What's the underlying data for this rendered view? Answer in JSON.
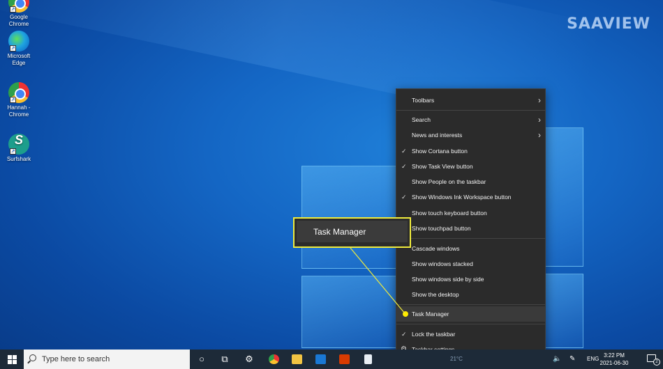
{
  "watermark": "SAAVIEW",
  "desktop": {
    "icons": [
      {
        "label": "Google Chrome"
      },
      {
        "label": "Microsoft Edge"
      },
      {
        "label": "Hannah - Chrome"
      },
      {
        "label": "Surfshark"
      }
    ]
  },
  "context_menu": {
    "items": [
      {
        "label": "Toolbars",
        "submenu": true
      },
      {
        "label": "Search",
        "submenu": true
      },
      {
        "label": "News and interests",
        "submenu": true
      },
      {
        "label": "Show Cortana button",
        "checked": true
      },
      {
        "label": "Show Task View button",
        "checked": true
      },
      {
        "label": "Show People on the taskbar"
      },
      {
        "label": "Show Windows Ink Workspace button",
        "checked": true
      },
      {
        "label": "Show touch keyboard button"
      },
      {
        "label": "Show touchpad button"
      },
      {
        "label": "Cascade windows"
      },
      {
        "label": "Show windows stacked"
      },
      {
        "label": "Show windows side by side"
      },
      {
        "label": "Show the desktop"
      },
      {
        "label": "Task Manager",
        "highlighted": true
      },
      {
        "label": "Lock the taskbar",
        "checked": true
      },
      {
        "label": "Taskbar settings"
      }
    ]
  },
  "callout": {
    "label": "Task Manager",
    "color": "#f0ec3c"
  },
  "taskbar": {
    "search_placeholder": "Type here to search",
    "tray": {
      "language": "ENG",
      "time": "3:22 PM",
      "date": "2021-06-30",
      "notifications": "2",
      "partial_text": "21°C"
    }
  }
}
